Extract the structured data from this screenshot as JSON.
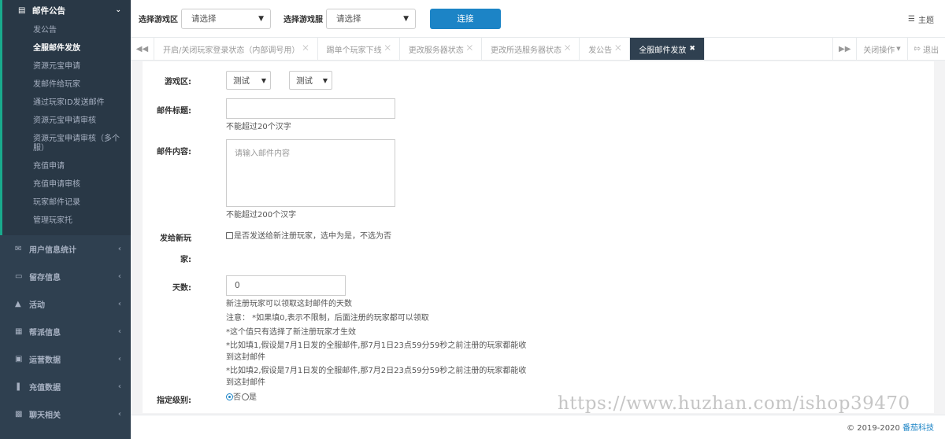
{
  "sidebar": {
    "active_section": "邮件公告",
    "sub_items": [
      "发公告",
      "全服邮件发放",
      "资源元宝申请",
      "发邮件给玩家",
      "通过玩家ID发送邮件",
      "资源元宝申请审核",
      "资源元宝申请审核（多个服）",
      "充值申请",
      "充值申请审核",
      "玩家邮件记录",
      "管理玩家托"
    ],
    "active_sub": "全服邮件发放",
    "sections": [
      {
        "label": "用户信息统计",
        "icon": "envelope-icon"
      },
      {
        "label": "留存信息",
        "icon": "monitor-icon"
      },
      {
        "label": "活动",
        "icon": "flask-icon"
      },
      {
        "label": "帮派信息",
        "icon": "grid-icon"
      },
      {
        "label": "运营数据",
        "icon": "image-icon"
      },
      {
        "label": "充值数据",
        "icon": "cutlery-icon"
      },
      {
        "label": "聊天相关",
        "icon": "chat-icon"
      }
    ]
  },
  "topbar": {
    "zone_label": "选择游戏区",
    "zone_value": "请选择",
    "server_label": "选择游戏服",
    "server_value": "请选择",
    "connect_label": "连接",
    "theme_label": "主题"
  },
  "tabs": {
    "items": [
      "开启/关闭玩家登录状态（内部调号用）",
      "踢单个玩家下线",
      "更改服务器状态",
      "更改所选服务器状态",
      "发公告",
      "全服邮件发放"
    ],
    "active": "全服邮件发放",
    "close_ops_label": "关闭操作",
    "exit_label": "退出"
  },
  "form": {
    "zone_label": "游戏区:",
    "zone_select_1": "测试",
    "zone_select_2": "测试",
    "title_label": "邮件标题:",
    "title_value": "",
    "title_help": "不能超过20个汉字",
    "content_label": "邮件内容:",
    "content_placeholder": "请输入邮件内容",
    "content_help": "不能超过200个汉字",
    "newplayer_label_1": "发给新玩",
    "newplayer_label_2": "家:",
    "newplayer_checkbox_text": "是否发送给新注册玩家，选中为是，不选为否",
    "days_label": "天数:",
    "days_value": "0",
    "days_help_1": "新注册玩家可以领取这封邮件的天数",
    "days_help_2": "注意： *如果填0,表示不限制，后面注册的玩家都可以领取",
    "days_help_3": "*这个值只有选择了新注册玩家才生效",
    "days_help_4a": "*比如填1,假设是7月1日发的全服邮件,那7月1日23点59分59秒之前注册的玩家都能收",
    "days_help_4b": "到这封邮件",
    "days_help_5a": "*比如填2,假设是7月1日发的全服邮件,那7月2日23点59分59秒之前注册的玩家都能收",
    "days_help_5b": "到这封邮件",
    "level_label": "指定级别:",
    "level_no": "否",
    "level_yes": "是"
  },
  "footer": {
    "copyright": "© 2019-2020",
    "brand": "番茄科技"
  },
  "watermark": "https://www.huzhan.com/ishop39470"
}
